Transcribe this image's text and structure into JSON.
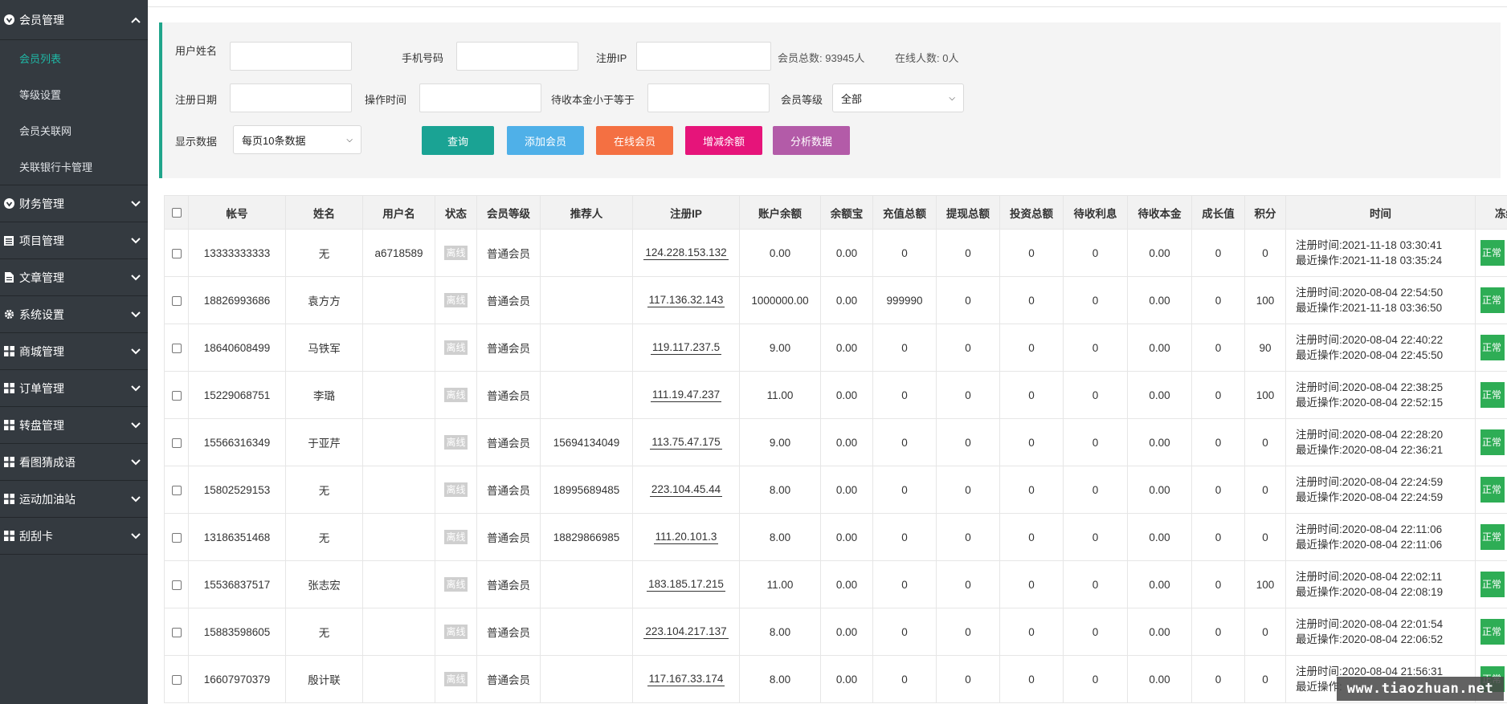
{
  "sidebar": {
    "groups": [
      {
        "label": "会员管理",
        "icon": "heart-circle-icon",
        "expanded": true
      },
      {
        "label": "财务管理",
        "icon": "heart-circle-icon"
      },
      {
        "label": "项目管理",
        "icon": "list-icon"
      },
      {
        "label": "文章管理",
        "icon": "document-icon"
      },
      {
        "label": "系统设置",
        "icon": "gear-icon"
      },
      {
        "label": "商城管理",
        "icon": "grid-icon"
      },
      {
        "label": "订单管理",
        "icon": "grid-icon"
      },
      {
        "label": "转盘管理",
        "icon": "grid-icon"
      },
      {
        "label": "看图猜成语",
        "icon": "grid-icon"
      },
      {
        "label": "运动加油站",
        "icon": "grid-icon"
      },
      {
        "label": "刮刮卡",
        "icon": "grid-icon"
      }
    ],
    "sub_items": [
      "会员列表",
      "等级设置",
      "会员关联网",
      "关联银行卡管理"
    ],
    "active_sub": "会员列表"
  },
  "filter": {
    "username_label": "用户姓名",
    "phone_label": "手机号码",
    "regip_label": "注册IP",
    "total_members_label": "会员总数:",
    "total_members": "93945人",
    "online_label": "在线人数:",
    "online_count": "0人",
    "regdate_label": "注册日期",
    "optime_label": "操作时间",
    "pending_label": "待收本金小于等于",
    "level_label": "会员等级",
    "level_value": "全部",
    "display_label": "显示数据",
    "display_value": "每页10条数据"
  },
  "buttons": {
    "query": "查询",
    "add_member": "添加会员",
    "online_members": "在线会员",
    "adjust_balance": "增减余额",
    "analyze": "分析数据"
  },
  "colors": {
    "sidebar_bg": "#343a40",
    "accent": "#20a58b",
    "query": "#1aa394",
    "add_member": "#4fb0e8",
    "online_members": "#f47042",
    "adjust_balance": "#e6147a",
    "analyze": "#b35ba8",
    "status_normal": "#2ead55"
  },
  "table": {
    "headers": [
      "帐号",
      "姓名",
      "用户名",
      "状态",
      "会员等级",
      "推荐人",
      "注册IP",
      "账户余额",
      "余额宝",
      "充值总额",
      "提现总额",
      "投资总额",
      "待收利息",
      "待收本金",
      "成长值",
      "积分",
      "时间",
      "冻结"
    ],
    "reg_prefix": "注册时间:",
    "op_prefix": "最近操作:",
    "rows": [
      {
        "account": "13333333333",
        "name": "无",
        "username": "a6718589",
        "status": "离线",
        "level": "普通会员",
        "referrer": "",
        "ip": "124.228.153.132",
        "balance": "0.00",
        "yeb": "0.00",
        "recharge": "0",
        "withdraw": "0",
        "invest": "0",
        "interest": "0",
        "principal": "0.00",
        "growth": "0",
        "points": "0",
        "reg_time": "2021-11-18 03:30:41",
        "op_time": "2021-11-18 03:35:24",
        "freeze": "正常"
      },
      {
        "account": "18826993686",
        "name": "袁方方",
        "username": "",
        "status": "离线",
        "level": "普通会员",
        "referrer": "",
        "ip": "117.136.32.143",
        "balance": "1000000.00",
        "yeb": "0.00",
        "recharge": "999990",
        "withdraw": "0",
        "invest": "0",
        "interest": "0",
        "principal": "0.00",
        "growth": "0",
        "points": "100",
        "reg_time": "2020-08-04 22:54:50",
        "op_time": "2021-11-18 03:36:50",
        "freeze": "正常"
      },
      {
        "account": "18640608499",
        "name": "马铁军",
        "username": "",
        "status": "离线",
        "level": "普通会员",
        "referrer": "",
        "ip": "119.117.237.5",
        "balance": "9.00",
        "yeb": "0.00",
        "recharge": "0",
        "withdraw": "0",
        "invest": "0",
        "interest": "0",
        "principal": "0.00",
        "growth": "0",
        "points": "90",
        "reg_time": "2020-08-04 22:40:22",
        "op_time": "2020-08-04 22:45:50",
        "freeze": "正常"
      },
      {
        "account": "15229068751",
        "name": "李璐",
        "username": "",
        "status": "离线",
        "level": "普通会员",
        "referrer": "",
        "ip": "111.19.47.237",
        "balance": "11.00",
        "yeb": "0.00",
        "recharge": "0",
        "withdraw": "0",
        "invest": "0",
        "interest": "0",
        "principal": "0.00",
        "growth": "0",
        "points": "100",
        "reg_time": "2020-08-04 22:38:25",
        "op_time": "2020-08-04 22:52:15",
        "freeze": "正常"
      },
      {
        "account": "15566316349",
        "name": "于亚芹",
        "username": "",
        "status": "离线",
        "level": "普通会员",
        "referrer": "15694134049",
        "ip": "113.75.47.175",
        "balance": "9.00",
        "yeb": "0.00",
        "recharge": "0",
        "withdraw": "0",
        "invest": "0",
        "interest": "0",
        "principal": "0.00",
        "growth": "0",
        "points": "0",
        "reg_time": "2020-08-04 22:28:20",
        "op_time": "2020-08-04 22:36:21",
        "freeze": "正常"
      },
      {
        "account": "15802529153",
        "name": "无",
        "username": "",
        "status": "离线",
        "level": "普通会员",
        "referrer": "18995689485",
        "ip": "223.104.45.44",
        "balance": "8.00",
        "yeb": "0.00",
        "recharge": "0",
        "withdraw": "0",
        "invest": "0",
        "interest": "0",
        "principal": "0.00",
        "growth": "0",
        "points": "0",
        "reg_time": "2020-08-04 22:24:59",
        "op_time": "2020-08-04 22:24:59",
        "freeze": "正常"
      },
      {
        "account": "13186351468",
        "name": "无",
        "username": "",
        "status": "离线",
        "level": "普通会员",
        "referrer": "18829866985",
        "ip": "111.20.101.3",
        "balance": "8.00",
        "yeb": "0.00",
        "recharge": "0",
        "withdraw": "0",
        "invest": "0",
        "interest": "0",
        "principal": "0.00",
        "growth": "0",
        "points": "0",
        "reg_time": "2020-08-04 22:11:06",
        "op_time": "2020-08-04 22:11:06",
        "freeze": "正常"
      },
      {
        "account": "15536837517",
        "name": "张志宏",
        "username": "",
        "status": "离线",
        "level": "普通会员",
        "referrer": "",
        "ip": "183.185.17.215",
        "balance": "11.00",
        "yeb": "0.00",
        "recharge": "0",
        "withdraw": "0",
        "invest": "0",
        "interest": "0",
        "principal": "0.00",
        "growth": "0",
        "points": "100",
        "reg_time": "2020-08-04 22:02:11",
        "op_time": "2020-08-04 22:08:19",
        "freeze": "正常"
      },
      {
        "account": "15883598605",
        "name": "无",
        "username": "",
        "status": "离线",
        "level": "普通会员",
        "referrer": "",
        "ip": "223.104.217.137",
        "balance": "8.00",
        "yeb": "0.00",
        "recharge": "0",
        "withdraw": "0",
        "invest": "0",
        "interest": "0",
        "principal": "0.00",
        "growth": "0",
        "points": "0",
        "reg_time": "2020-08-04 22:01:54",
        "op_time": "2020-08-04 22:06:52",
        "freeze": "正常"
      },
      {
        "account": "16607970379",
        "name": "殷计联",
        "username": "",
        "status": "离线",
        "level": "普通会员",
        "referrer": "",
        "ip": "117.167.33.174",
        "balance": "8.00",
        "yeb": "0.00",
        "recharge": "0",
        "withdraw": "0",
        "invest": "0",
        "interest": "0",
        "principal": "0.00",
        "growth": "0",
        "points": "0",
        "reg_time": "2020-08-04 21:56:31",
        "op_time": "",
        "freeze": "正常"
      }
    ]
  },
  "watermark": "www.tiaozhuan.net"
}
